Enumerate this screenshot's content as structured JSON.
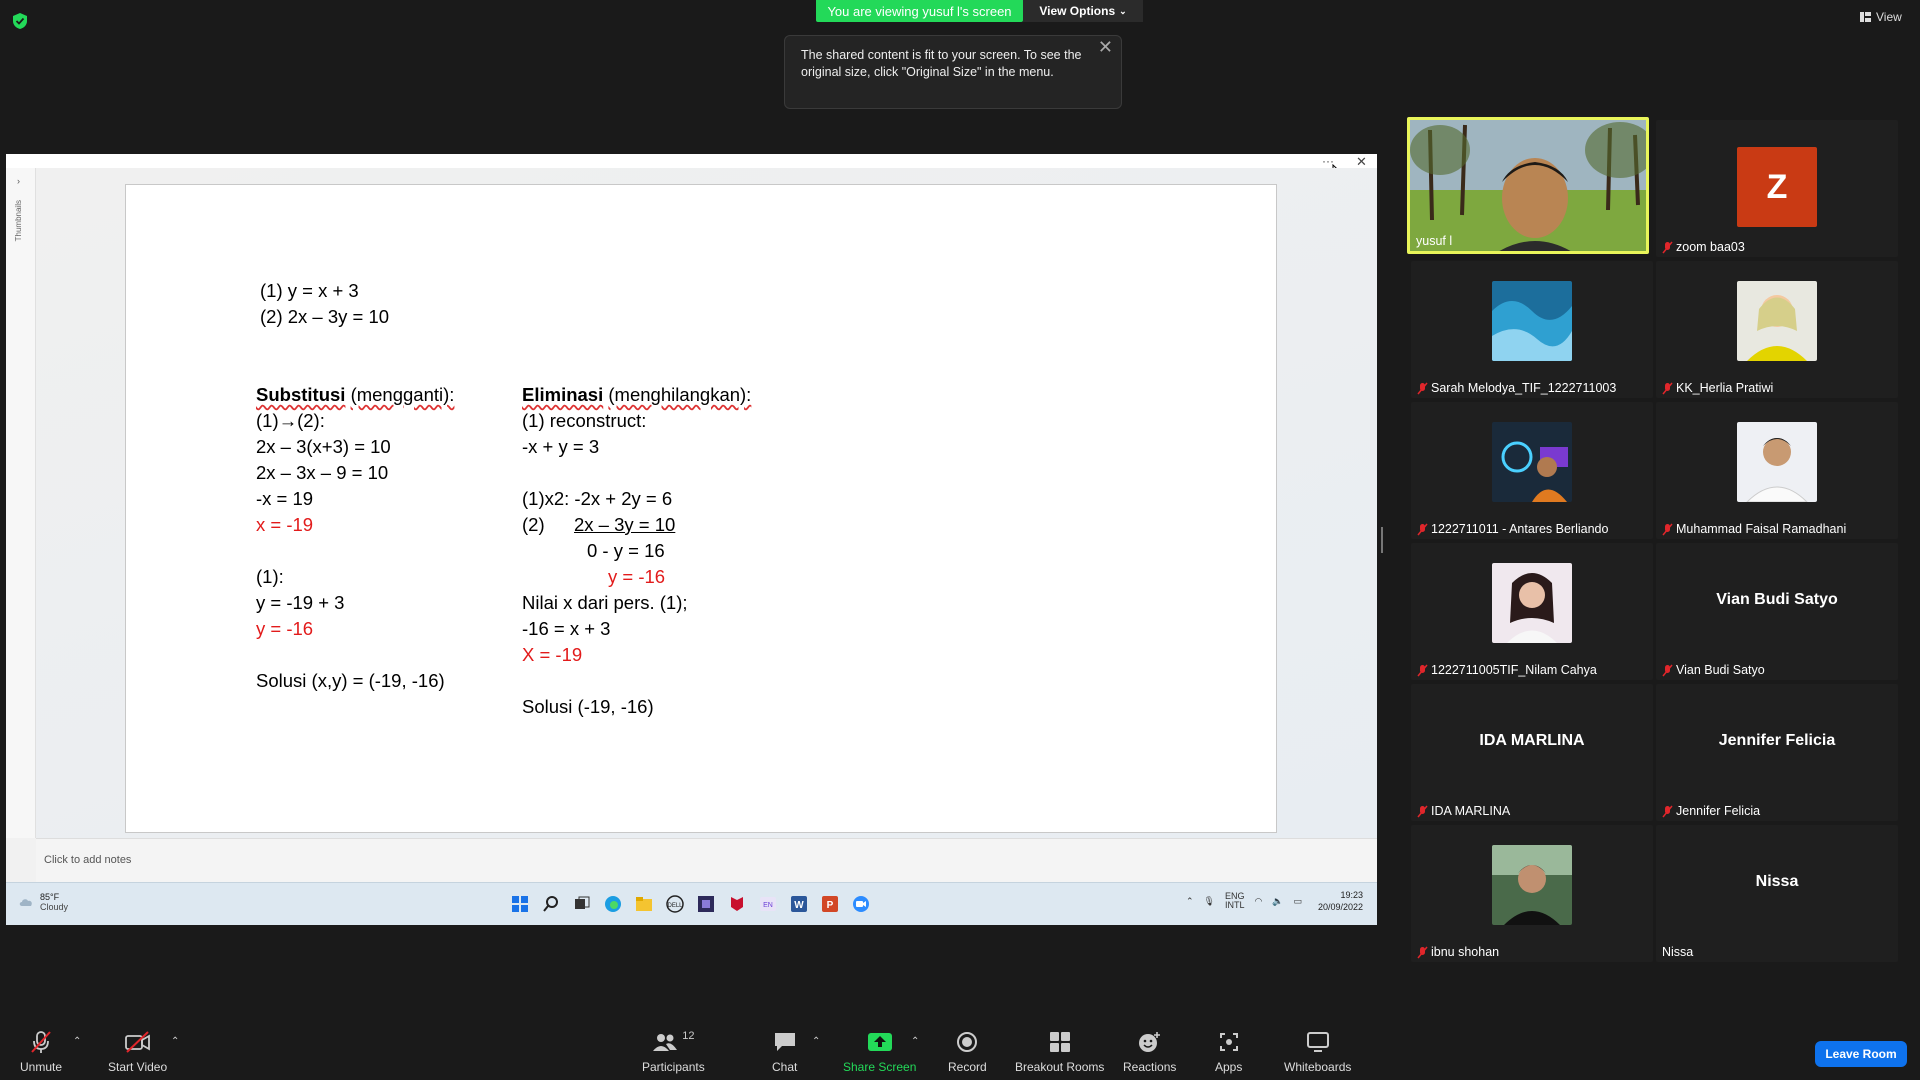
{
  "top": {
    "viewing_banner": "You are viewing yusuf l's screen",
    "view_options": "View Options",
    "view_label": "View",
    "tooltip_text": "The shared content is fit to your screen. To see the original size, click \"Original Size\" in the menu."
  },
  "ppt": {
    "thumbnails_label": "Thumbnails",
    "notes_placeholder": "Click to add notes",
    "slide": {
      "eq1": "(1) y = x + 3",
      "eq2": "(2) 2x – 3y = 10",
      "subst_title": "Substitusi",
      "subst_paren": "(mengganti):",
      "subst_lines": [
        "(1)→(2):",
        "2x – 3(x+3) = 10",
        "2x – 3x – 9 = 10",
        "-x = 19",
        "x = -19",
        "(1):",
        "y = -19 + 3",
        "y = -16",
        "Solusi (x,y) = (-19, -16)"
      ],
      "elim_title": "Eliminasi",
      "elim_paren": "(menghilangkan):",
      "elim_lines": [
        "(1)  reconstruct:",
        "-x + y = 3",
        "(1)x2: -2x + 2y = 6",
        "(2)",
        "2x – 3y = 10",
        "0  - y = 16",
        "y = -16",
        "Nilai x dari pers. (1);",
        "-16 = x + 3",
        "X = -19",
        "Solusi (-19, -16)"
      ]
    }
  },
  "taskbar": {
    "weather_temp": "85°F",
    "weather_desc": "Cloudy",
    "lang": "ENG",
    "lang_sub": "INTL",
    "time": "19:23",
    "date": "20/09/2022"
  },
  "participants": [
    {
      "name": "yusuf l",
      "muted": false,
      "type": "video"
    },
    {
      "name": "zoom baa03",
      "muted": true,
      "type": "avatar",
      "initial": "Z"
    },
    {
      "name": "Sarah Melodya_TIF_1222711003",
      "muted": true,
      "type": "photo"
    },
    {
      "name": "KK_Herlia Pratiwi",
      "muted": true,
      "type": "photo"
    },
    {
      "name": "1222711011 - Antares Berliando",
      "muted": true,
      "type": "photo"
    },
    {
      "name": "Muhammad Faisal Ramadhani",
      "muted": true,
      "type": "photo"
    },
    {
      "name": "1222711005TIF_Nilam Cahya",
      "muted": true,
      "type": "photo"
    },
    {
      "name": "Vian Budi Satyo",
      "muted": true,
      "type": "text",
      "big": "Vian Budi Satyo"
    },
    {
      "name": "IDA MARLINA",
      "muted": true,
      "type": "text",
      "big": "IDA MARLINA"
    },
    {
      "name": "Jennifer Felicia",
      "muted": true,
      "type": "text",
      "big": "Jennifer Felicia"
    },
    {
      "name": "ibnu shohan",
      "muted": true,
      "type": "photo"
    },
    {
      "name": "Nissa",
      "muted": false,
      "type": "text",
      "big": "Nissa"
    }
  ],
  "toolbar": {
    "unmute": "Unmute",
    "start_video": "Start Video",
    "participants": "Participants",
    "participants_count": "12",
    "chat": "Chat",
    "share_screen": "Share Screen",
    "record": "Record",
    "breakout_rooms": "Breakout Rooms",
    "reactions": "Reactions",
    "apps": "Apps",
    "whiteboards": "Whiteboards",
    "leave_room": "Leave Room"
  },
  "colors": {
    "banner_green": "#23d959",
    "active_speaker": "#e9f55a",
    "share_green": "#23d959",
    "leave_blue": "#0e72ed",
    "mute_red": "#e0262b",
    "slide_red": "#e21b1b"
  }
}
